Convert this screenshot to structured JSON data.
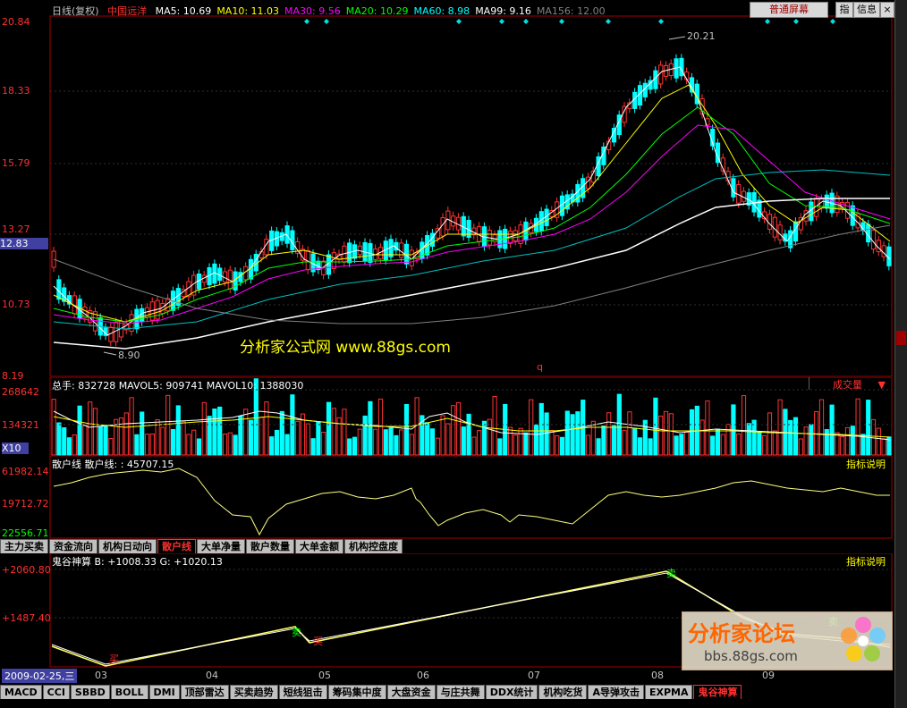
{
  "main_panel": {
    "period": "日线(复权)",
    "stock_name": "中国远洋",
    "ma": [
      {
        "label": "MA5: 10.69",
        "color": "#ffffff"
      },
      {
        "label": "MA10: 11.03",
        "color": "#ffff00"
      },
      {
        "label": "MA30: 9.56",
        "color": "#ff00ff"
      },
      {
        "label": "MA20: 10.29",
        "color": "#00ff00"
      },
      {
        "label": "MA60: 8.98",
        "color": "#00ffff"
      },
      {
        "label": "MA99: 9.16",
        "color": "#ffffff"
      },
      {
        "label": "MA156: 12.00",
        "color": "#808080"
      }
    ],
    "screen_mode_button": "普通屏幕",
    "zhi_button": "指",
    "info_button": "信息",
    "price_ticks": [
      "20.84",
      "18.33",
      "15.79",
      "13.27",
      "12.83",
      "10.73",
      "8.19"
    ],
    "high_label": "20.21",
    "low_label": "8.90",
    "q_marker": "q",
    "watermark": "分析家公式网 www.88gs.com"
  },
  "volume_panel": {
    "title": "总手: 832728  MAVOL5: 909741  MAVOL10: 1388030",
    "selector": "成交量",
    "ticks": [
      "268642",
      "134321",
      "X10"
    ]
  },
  "sanhu_panel": {
    "title": "散户线  散户线: : 45707.15",
    "help": "指标说明",
    "ticks": [
      "61982.14",
      "19712.72",
      "22556.71"
    ]
  },
  "mid_tabs": [
    "主力买卖",
    "资金流向",
    "机构日动向",
    "散户线",
    "大单净量",
    "散户数量",
    "大单金额",
    "机构控盘度"
  ],
  "mid_tab_active": 3,
  "guigu_panel": {
    "title": "鬼谷神算  B: +1008.33  G: +1020.13",
    "help": "指标说明",
    "ticks": [
      "+2060.80",
      "+1487.40"
    ],
    "signals": [
      "买",
      "卖",
      "买",
      "卖",
      "卖"
    ]
  },
  "date_axis": {
    "current_date": "2009-02-25,三",
    "months": [
      "03",
      "04",
      "05",
      "06",
      "07",
      "08",
      "09"
    ]
  },
  "bottom_tabs": [
    "MACD",
    "CCI",
    "SBBD",
    "BOLL",
    "DMI",
    "顶部雷达",
    "买卖趋势",
    "短线狙击",
    "筹码集中度",
    "大盘资金",
    "与庄共舞",
    "DDX统计",
    "机构吃货",
    "A导弹攻击",
    "EXPMA",
    "鬼谷神算"
  ],
  "bottom_tab_active": 15,
  "forum_watermark": {
    "title": "分析家论坛",
    "url": "bbs.88gs.com"
  },
  "colors": {
    "up": "#ff3232",
    "down": "#00ffff",
    "axis": "#ff3030",
    "panel_border": "#a00000"
  }
}
